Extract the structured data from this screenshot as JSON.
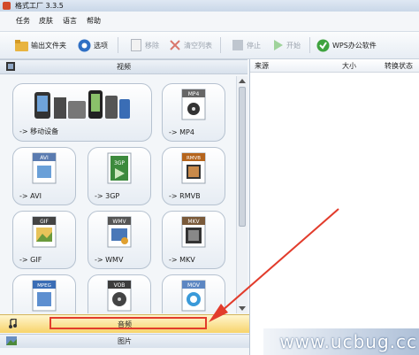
{
  "window": {
    "title": "格式工厂 3.3.5"
  },
  "menu": [
    "任务",
    "皮肤",
    "语言",
    "帮助"
  ],
  "toolbar": {
    "output_folder": "输出文件夹",
    "options": "选项",
    "remove": "移除",
    "clear_list": "清空列表",
    "stop": "停止",
    "start": "开始",
    "wps": "WPS办公软件"
  },
  "sections": {
    "video": "视频",
    "audio": "音频",
    "picture": "图片"
  },
  "tiles": [
    {
      "label": "-> 移动设备"
    },
    {
      "label": "-> MP4",
      "badge": "MP4"
    },
    {
      "label": "-> AVI",
      "badge": "AVI"
    },
    {
      "label": "-> 3GP",
      "badge": "3GP"
    },
    {
      "label": "-> RMVB",
      "badge": "RMVB"
    },
    {
      "label": "-> GIF",
      "badge": "GIF"
    },
    {
      "label": "-> WMV",
      "badge": "WMV"
    },
    {
      "label": "-> MKV",
      "badge": "MKV"
    },
    {
      "label": "",
      "badge": "MPEG"
    },
    {
      "label": "",
      "badge": "VOB"
    },
    {
      "label": "",
      "badge": "MOV"
    }
  ],
  "task_list": {
    "columns": [
      "来源",
      "大小",
      "转换状态"
    ]
  },
  "watermark": "www.ucbug.cc",
  "colors": {
    "highlight": "#e23c2c",
    "audio_bar": "#f7d36a"
  }
}
